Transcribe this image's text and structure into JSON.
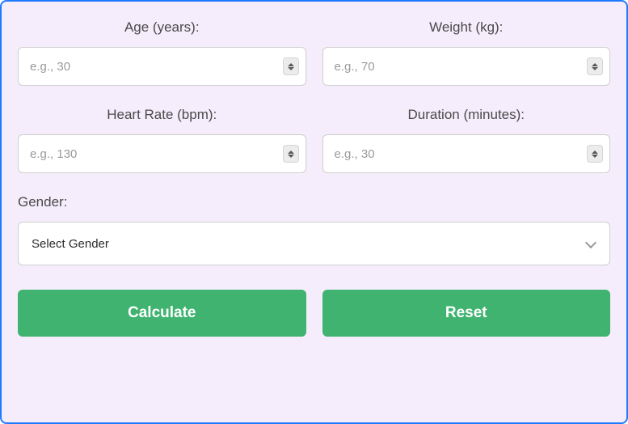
{
  "fields": {
    "age": {
      "label": "Age (years):",
      "placeholder": "e.g., 30",
      "value": ""
    },
    "weight": {
      "label": "Weight (kg):",
      "placeholder": "e.g., 70",
      "value": ""
    },
    "hr": {
      "label": "Heart Rate (bpm):",
      "placeholder": "e.g., 130",
      "value": ""
    },
    "duration": {
      "label": "Duration (minutes):",
      "placeholder": "e.g., 30",
      "value": ""
    }
  },
  "gender": {
    "label": "Gender:",
    "selected": "Select Gender"
  },
  "buttons": {
    "calculate": "Calculate",
    "reset": "Reset"
  }
}
